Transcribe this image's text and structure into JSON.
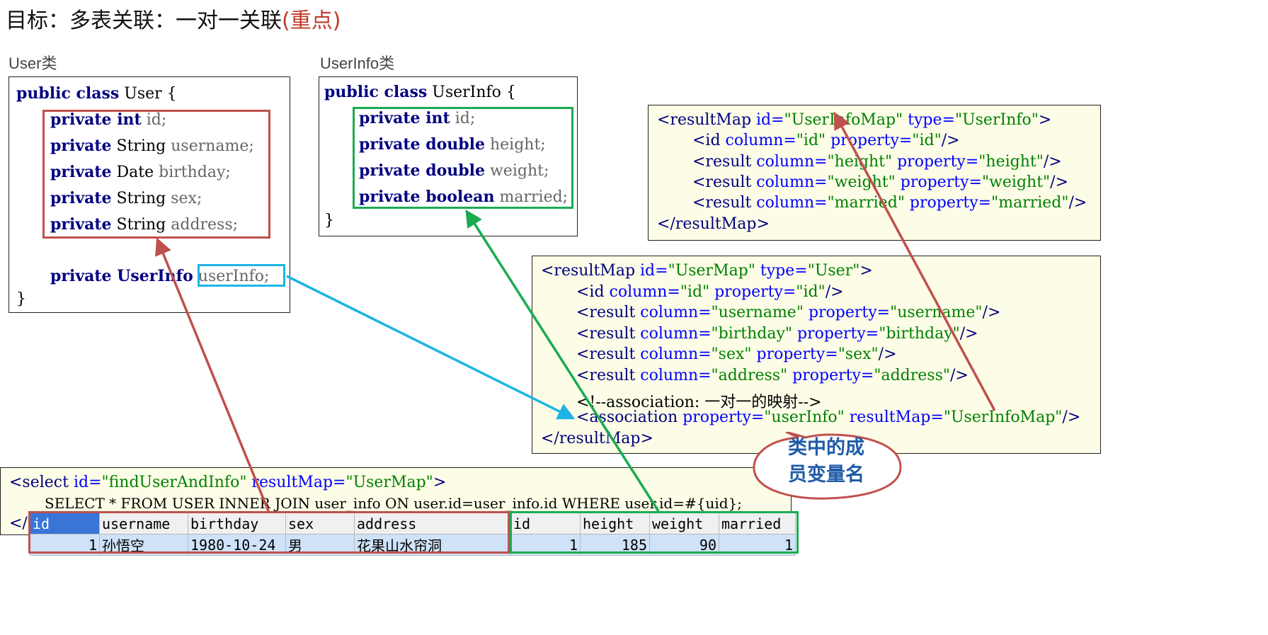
{
  "title": {
    "main": "目标：多表关联：一对一关联",
    "emphasis": "(重点)"
  },
  "user_class": {
    "label": "User类",
    "line1_kw": "public class",
    "line1_name": " User {",
    "fields": [
      {
        "kw": "private int",
        "var": " id;"
      },
      {
        "kw": "private",
        "type": " String",
        "var": " username;"
      },
      {
        "kw": "private",
        "type": " Date",
        "var": " birthday;"
      },
      {
        "kw": "private",
        "type": " String",
        "var": " sex;"
      },
      {
        "kw": "private",
        "type": " String",
        "var": " address;"
      }
    ],
    "assoc_prefix": "private UserInfo",
    "assoc_var": "userInfo;",
    "close": "}"
  },
  "userinfo_class": {
    "label": "UserInfo类",
    "line1_kw": "public class",
    "line1_name": " UserInfo {",
    "fields": [
      {
        "kw": "private int",
        "var": " id;"
      },
      {
        "kw": "private double",
        "var": " height;"
      },
      {
        "kw": "private double",
        "var": " weight;"
      },
      {
        "kw": "private boolean",
        "var": " married;"
      }
    ],
    "close": "}"
  },
  "userinfo_map": {
    "open_tag": "<resultMap",
    "id_attr": " id=",
    "id_val": "\"UserInfoMap\"",
    "type_attr": " type=",
    "type_val": "\"UserInfo\"",
    "open_end": ">",
    "rows": [
      {
        "tag": "<id",
        "col": "\"id\"",
        "prop": "\"id\""
      },
      {
        "tag": "<result",
        "col": "\"height\"",
        "prop": "\"height\""
      },
      {
        "tag": "<result",
        "col": "\"weight\"",
        "prop": "\"weight\""
      },
      {
        "tag": "<result",
        "col": "\"married\"",
        "prop": "\"married\""
      }
    ],
    "column_attr": " column=",
    "property_attr": " property=",
    "self_close": "/>",
    "close_tag": "</resultMap>"
  },
  "user_map": {
    "open_tag": "<resultMap",
    "id_attr": " id=",
    "id_val": "\"UserMap\"",
    "type_attr": " type=",
    "type_val": "\"User\"",
    "open_end": ">",
    "rows": [
      {
        "tag": "<id",
        "col": "\"id\"",
        "prop": "\"id\""
      },
      {
        "tag": "<result",
        "col": "\"username\"",
        "prop": "\"username\""
      },
      {
        "tag": "<result",
        "col": "\"birthday\"",
        "prop": "\"birthday\""
      },
      {
        "tag": "<result",
        "col": "\"sex\"",
        "prop": "\"sex\""
      },
      {
        "tag": "<result",
        "col": "\"address\"",
        "prop": "\"address\""
      }
    ],
    "column_attr": " column=",
    "property_attr": " property=",
    "self_close": "/>",
    "comment": "<!--association: 一对一的映射-->",
    "assoc_tag": "<association",
    "assoc_prop_attr": " property=",
    "assoc_prop_val": "\"userInfo\"",
    "assoc_rm_attr": " resultMap=",
    "assoc_rm_val": "\"UserInfoMap\"",
    "close_tag": "</resultMap>"
  },
  "select": {
    "open_tag": "<select",
    "id_attr": " id=",
    "id_val": "\"findUserAndInfo\"",
    "rm_attr": " resultMap=",
    "rm_val": "\"UserMap\"",
    "open_end": ">",
    "sql": "SELECT * FROM USER INNER JOIN user_info ON user.id=user_info.id WHERE user.id=#{uid};",
    "close_tag": "</"
  },
  "result_grid": {
    "headers": [
      "id",
      "username",
      "birthday",
      "sex",
      "address",
      "id",
      "height",
      "weight",
      "married"
    ],
    "row": [
      "1",
      "孙悟空",
      "1980-10-24",
      "男",
      "花果山水帘洞",
      "1",
      "185",
      "90",
      "1"
    ]
  },
  "bubble": {
    "line1": "类中的成",
    "line2": "员变量名"
  },
  "colors": {
    "red": "#c0504d",
    "green": "#1aab52",
    "blue": "#1eb4e6",
    "title_em": "#c0392b"
  }
}
